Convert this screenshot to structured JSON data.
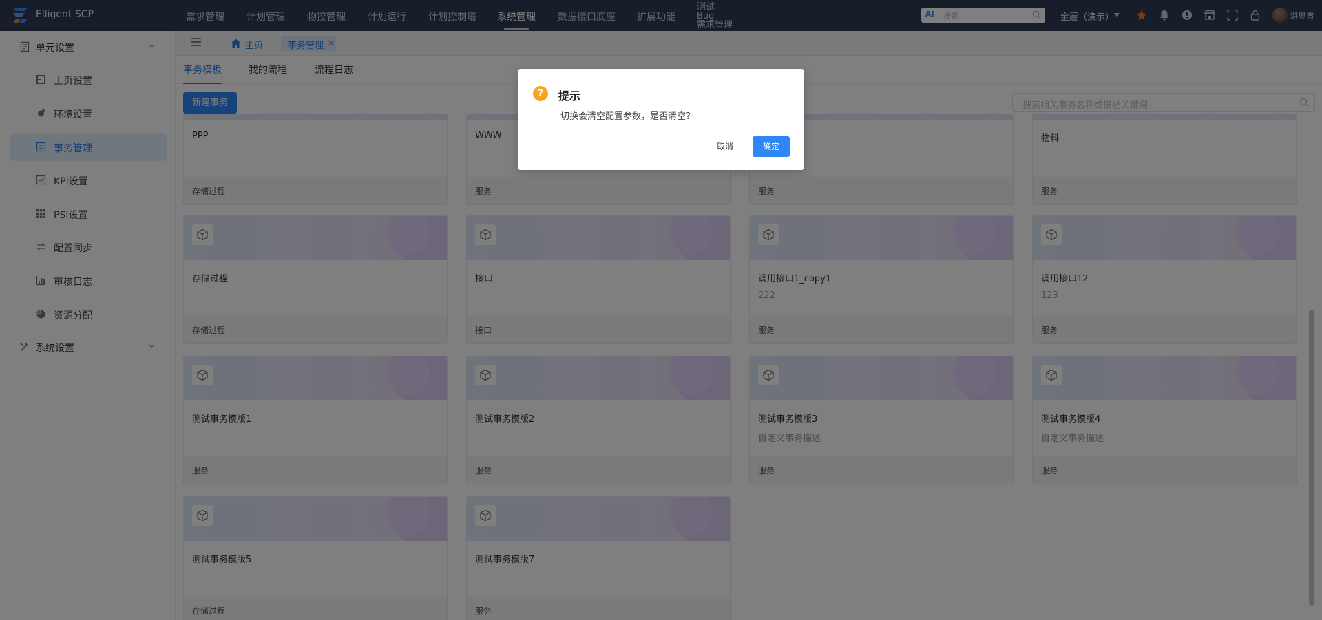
{
  "app": {
    "title": "Elligent SCP",
    "logo_icon": "elligent-logo"
  },
  "topnav": {
    "items": [
      "需求管理",
      "计划管理",
      "物控管理",
      "计划运行",
      "计划控制塔",
      "系统管理",
      "数据接口底座",
      "扩展功能"
    ],
    "active": "系统管理",
    "multi_line_item": [
      "测试",
      "Bug",
      "需求管理"
    ]
  },
  "header": {
    "search_ai_label": "AI",
    "search_placeholder": "搜索",
    "org_select": "金履（演示）",
    "username": "洪奥青",
    "icons": [
      "star-icon",
      "bell-icon",
      "info-icon",
      "store-icon",
      "fullscreen-icon",
      "lock-icon"
    ],
    "star_color": "#f07a2a"
  },
  "sidebar": {
    "group1": "单元设置",
    "items": [
      {
        "label": "主页设置",
        "icon": "dashboard-icon"
      },
      {
        "label": "环境设置",
        "icon": "environment-icon"
      },
      {
        "label": "事务管理",
        "icon": "list-icon",
        "active": true
      },
      {
        "label": "KPI设置",
        "icon": "kpi-icon"
      },
      {
        "label": "PSI设置",
        "icon": "grid-icon"
      },
      {
        "label": "配置同步",
        "icon": "sync-icon"
      },
      {
        "label": "审核日志",
        "icon": "bar-chart-icon"
      },
      {
        "label": "资源分配",
        "icon": "pie-icon"
      }
    ],
    "group2": "系统设置"
  },
  "breadcrumb": {
    "home": "主页",
    "current_tab": "事务管理",
    "close": "×"
  },
  "subtabs": [
    "事务模板",
    "我的流程",
    "流程日志"
  ],
  "toolbar": {
    "new_button": "新建事务",
    "search_placeholder": "搜索相关事务名称或描述关键词"
  },
  "cards_top_row": [
    {
      "title": "PPP",
      "type": "存储过程"
    },
    {
      "title": "WWW",
      "type": "服务"
    },
    {
      "title": "",
      "type": "服务"
    },
    {
      "title": "物料",
      "type": "服务"
    }
  ],
  "cards": [
    {
      "title": "存储过程",
      "desc": "",
      "type": "存储过程"
    },
    {
      "title": "接口",
      "desc": "",
      "type": "接口"
    },
    {
      "title": "调用接口1_copy1",
      "desc": "222",
      "type": "服务"
    },
    {
      "title": "调用接口12",
      "desc": "123",
      "type": "服务"
    },
    {
      "title": "测试事务模版1",
      "desc": "",
      "type": "服务"
    },
    {
      "title": "测试事务模版2",
      "desc": "",
      "type": "服务"
    },
    {
      "title": "测试事务模版3",
      "desc": "自定义事务描述",
      "type": "服务"
    },
    {
      "title": "测试事务模版4",
      "desc": "自定义事务描述",
      "type": "服务"
    },
    {
      "title": "测试事务模版5",
      "desc": "",
      "type": "存储过程"
    },
    {
      "title": "测试事务模版7",
      "desc": "",
      "type": "服务"
    }
  ],
  "dialog": {
    "title": "提示",
    "icon": "question-icon",
    "icon_glyph": "?",
    "message": "切换会清空配置参数，是否清空?",
    "cancel": "取消",
    "confirm": "确定"
  }
}
